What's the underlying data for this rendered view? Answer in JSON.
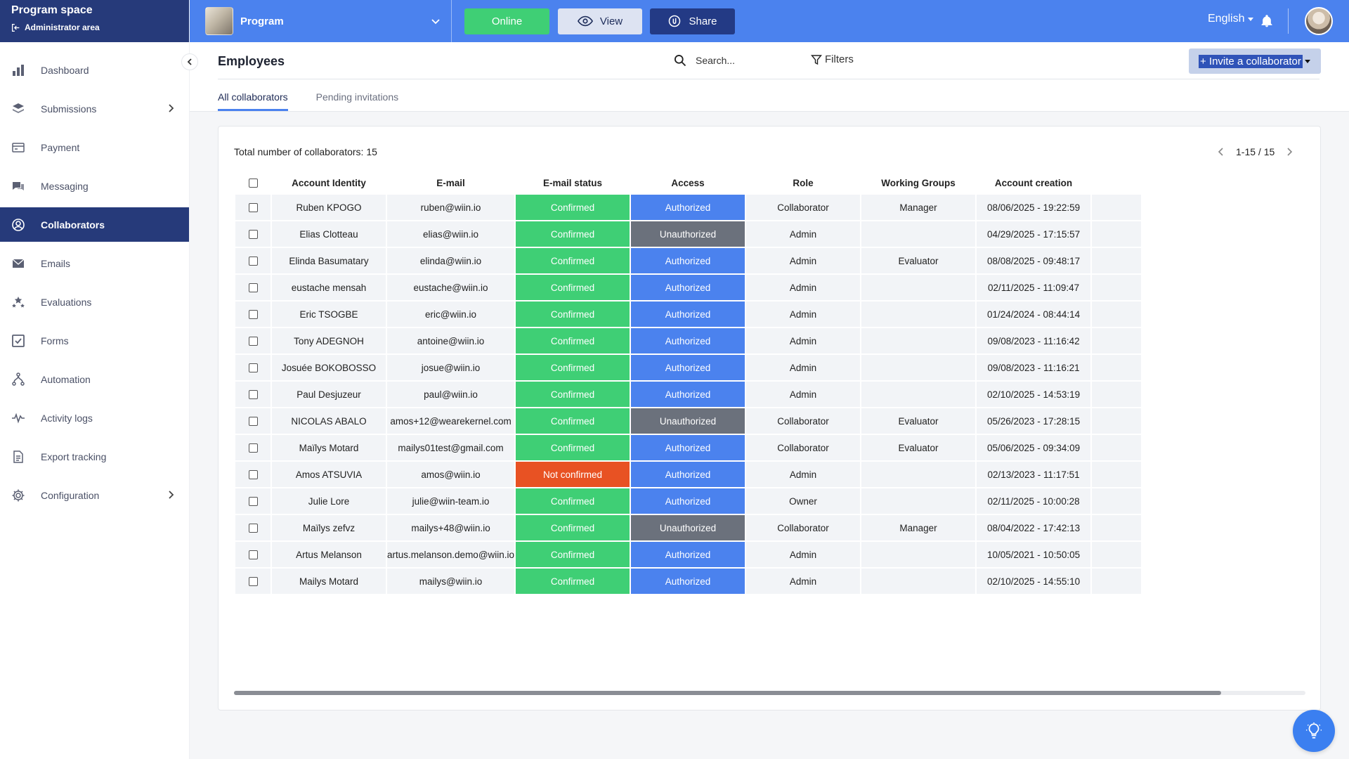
{
  "brand": {
    "title": "Program space",
    "subtitle": "Administrator area"
  },
  "sidebar": {
    "items": [
      {
        "label": "Dashboard",
        "icon": "bar-chart-icon"
      },
      {
        "label": "Submissions",
        "icon": "layers-icon",
        "has_submenu": true
      },
      {
        "label": "Payment",
        "icon": "credit-card-icon"
      },
      {
        "label": "Messaging",
        "icon": "chat-icon"
      },
      {
        "label": "Collaborators",
        "icon": "user-circle-icon",
        "active": true
      },
      {
        "label": "Emails",
        "icon": "envelope-icon"
      },
      {
        "label": "Evaluations",
        "icon": "stars-icon"
      },
      {
        "label": "Forms",
        "icon": "checkbox-icon"
      },
      {
        "label": "Automation",
        "icon": "automation-icon"
      },
      {
        "label": "Activity logs",
        "icon": "pulse-icon"
      },
      {
        "label": "Export tracking",
        "icon": "export-document-icon"
      },
      {
        "label": "Configuration",
        "icon": "gear-icon",
        "has_submenu": true
      }
    ]
  },
  "topbar": {
    "program_name": "Program",
    "online_label": "Online",
    "view_label": "View",
    "share_label": "Share",
    "language": "English"
  },
  "page": {
    "title": "Employees",
    "search_placeholder": "Search...",
    "filters_label": "Filters",
    "invite_label": "+ Invite a collaborator",
    "tabs": [
      {
        "label": "All collaborators",
        "active": true
      },
      {
        "label": "Pending invitations",
        "active": false
      }
    ]
  },
  "table": {
    "total_text": "Total number of collaborators: 15",
    "pagination": "1-15 / 15",
    "columns": [
      "Account Identity",
      "E-mail",
      "E-mail status",
      "Access",
      "Role",
      "Working Groups",
      "Account creation"
    ],
    "rows": [
      [
        "Ruben KPOGO",
        "ruben@wiin.io",
        "Confirmed",
        "Authorized",
        "Collaborator",
        "Manager",
        "08/06/2025 - 19:22:59"
      ],
      [
        "Elias Clotteau",
        "elias@wiin.io",
        "Confirmed",
        "Unauthorized",
        "Admin",
        "",
        "04/29/2025 - 17:15:57"
      ],
      [
        "Elinda Basumatary",
        "elinda@wiin.io",
        "Confirmed",
        "Authorized",
        "Admin",
        "Evaluator",
        "08/08/2025 - 09:48:17"
      ],
      [
        "eustache mensah",
        "eustache@wiin.io",
        "Confirmed",
        "Authorized",
        "Admin",
        "",
        "02/11/2025 - 11:09:47"
      ],
      [
        "Eric TSOGBE",
        "eric@wiin.io",
        "Confirmed",
        "Authorized",
        "Admin",
        "",
        "01/24/2024 - 08:44:14"
      ],
      [
        "Tony ADEGNOH",
        "antoine@wiin.io",
        "Confirmed",
        "Authorized",
        "Admin",
        "",
        "09/08/2023 - 11:16:42"
      ],
      [
        "Josuée BOKOBOSSO",
        "josue@wiin.io",
        "Confirmed",
        "Authorized",
        "Admin",
        "",
        "09/08/2023 - 11:16:21"
      ],
      [
        "Paul Desjuzeur",
        "paul@wiin.io",
        "Confirmed",
        "Authorized",
        "Admin",
        "",
        "02/10/2025 - 14:53:19"
      ],
      [
        "NICOLAS ABALO",
        "amos+12@wearekernel.com",
        "Confirmed",
        "Unauthorized",
        "Collaborator",
        "Evaluator",
        "05/26/2023 - 17:28:15"
      ],
      [
        "Maïlys Motard",
        "mailys01test@gmail.com",
        "Confirmed",
        "Authorized",
        "Collaborator",
        "Evaluator",
        "05/06/2025 - 09:34:09"
      ],
      [
        "Amos ATSUVIA",
        "amos@wiin.io",
        "Not confirmed",
        "Authorized",
        "Admin",
        "",
        "02/13/2023 - 11:17:51"
      ],
      [
        "Julie Lore",
        "julie@wiin-team.io",
        "Confirmed",
        "Authorized",
        "Owner",
        "",
        "02/11/2025 - 10:00:28"
      ],
      [
        "Maïlys zefvz",
        "mailys+48@wiin.io",
        "Confirmed",
        "Unauthorized",
        "Collaborator",
        "Manager",
        "08/04/2022 - 17:42:13"
      ],
      [
        "Artus Melanson",
        "artus.melanson.demo@wiin.io",
        "Confirmed",
        "Authorized",
        "Admin",
        "",
        "10/05/2021 - 10:50:05"
      ],
      [
        "Mailys Motard",
        "mailys@wiin.io",
        "Confirmed",
        "Authorized",
        "Admin",
        "",
        "02/10/2025 - 14:55:10"
      ]
    ]
  },
  "colors": {
    "sidebar_active": "#263a7a",
    "topbar": "#4b82ee",
    "confirmed": "#3fcf75",
    "not_confirmed": "#e85223",
    "authorized": "#4b82ee",
    "unauthorized": "#6b717c"
  }
}
